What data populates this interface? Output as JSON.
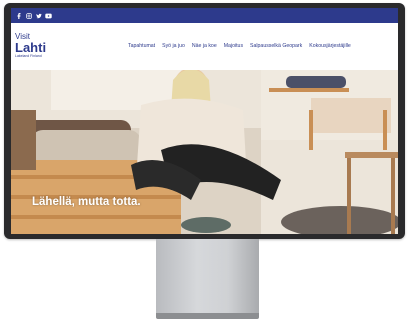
{
  "social": {
    "icons": [
      "facebook-icon",
      "instagram-icon",
      "twitter-icon",
      "youtube-icon"
    ],
    "bar_color": "#2d3a8c"
  },
  "logo": {
    "line1": "Visit",
    "line2": "Lahti",
    "line3": "Lakeland Finland",
    "color": "#2d3a8c"
  },
  "nav": {
    "items": [
      "Tapahtumat",
      "Syö ja juo",
      "Näe ja koe",
      "Majoitus",
      "Salpausselkä Geopark",
      "Kokousjärjestäjille"
    ]
  },
  "hero": {
    "title": "Lähellä, mutta totta."
  }
}
